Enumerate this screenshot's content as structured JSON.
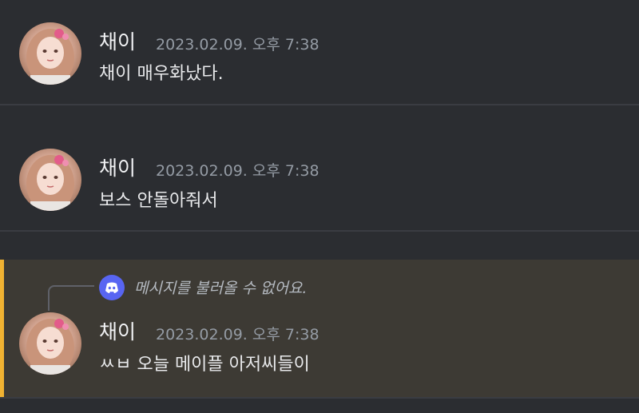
{
  "messages": [
    {
      "author": "채이",
      "timestamp": "2023.02.09. 오후 7:38",
      "text": "채이 매우화났다."
    },
    {
      "author": "채이",
      "timestamp": "2023.02.09. 오후 7:38",
      "text": "보스 안돌아줘서"
    },
    {
      "author": "채이",
      "timestamp": "2023.02.09. 오후 7:38",
      "text": "ㅆㅂ 오늘 메이플 아저씨들이",
      "reply": {
        "icon": "discord-icon",
        "text": "메시지를 불러올 수 없어요."
      }
    }
  ],
  "colors": {
    "background": "#2b2d31",
    "highlight": "#3d3a34",
    "highlight_bar": "#f0b232",
    "timestamp": "#949ba4",
    "discord_blurple": "#5865f2"
  }
}
